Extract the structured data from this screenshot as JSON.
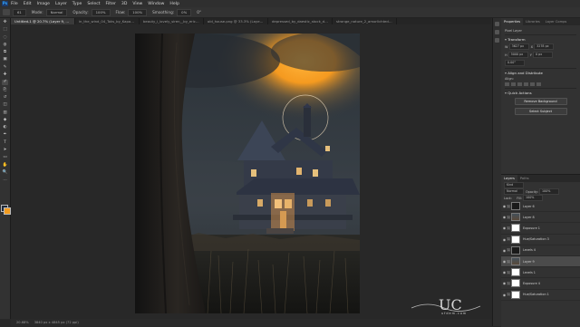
{
  "menu": {
    "logo": "Ps",
    "items": [
      "File",
      "Edit",
      "Image",
      "Layer",
      "Type",
      "Select",
      "Filter",
      "3D",
      "View",
      "Window",
      "Help"
    ]
  },
  "options": {
    "size": "61",
    "mode_label": "Mode:",
    "mode": "Normal",
    "opacity_label": "Opacity:",
    "opacity": "100%",
    "flow_label": "Flow:",
    "flow": "100%",
    "smoothing_label": "Smoothing:",
    "smoothing": "0%",
    "angle": "0°"
  },
  "tabs": [
    {
      "label": "Untitled-1 @ 20.7% (Layer 9, RGB/8#) *",
      "active": true
    },
    {
      "label": "in_the_wind_04_Toks_by_Kapacetstck_d57i8bst.jpg",
      "active": false
    },
    {
      "label": "beauty_i_lovely_siren__by_erica_stock_d3fq6bu.jpg",
      "active": false
    },
    {
      "label": "old_house.png @ 33.3% (Layer 1, RG...",
      "active": false
    },
    {
      "label": "depressed_by_daestic_stock_d15j1m.pnd @...",
      "active": false
    },
    {
      "label": "strange_nature_2_amorlichted_by_storel",
      "active": false
    }
  ],
  "tools": [
    "move-icon",
    "marquee-icon",
    "lasso-icon",
    "quick-select-icon",
    "crop-icon",
    "frame-icon",
    "eyedropper-icon",
    "spot-heal-icon",
    "brush-icon",
    "clone-stamp-icon",
    "history-brush-icon",
    "eraser-icon",
    "gradient-icon",
    "blur-icon",
    "dodge-icon",
    "pen-icon",
    "type-icon",
    "path-select-icon",
    "rectangle-icon",
    "hand-icon",
    "zoom-icon",
    "more-icon"
  ],
  "tool_glyphs": [
    "✥",
    "⬚",
    "◌",
    "◍",
    "⧉",
    "▣",
    "✎",
    "✚",
    "✐",
    "⎘",
    "↺",
    "◫",
    "▥",
    "◆",
    "◐",
    "✒",
    "T",
    "➤",
    "▭",
    "✋",
    "🔍",
    "…"
  ],
  "colors": {
    "foreground": "#1f2a3a",
    "background": "#f39c1f",
    "accent": "#31a8ff"
  },
  "properties": {
    "tabs": [
      "Properties",
      "Libraries",
      "Layer Comps"
    ],
    "layer_type": "Pixel Layer",
    "transform_title": "Transform",
    "w_label": "W",
    "w": "3627 px",
    "h_label": "H",
    "h": "5000 px",
    "x_label": "X",
    "x": "3278 px",
    "y_label": "Y",
    "y": "0 px",
    "angle": "0.00°",
    "align_title": "Align and Distribute",
    "align_sub": "Align:",
    "quick_title": "Quick Actions",
    "remove_bg": "Remove Background",
    "select_subject": "Select Subject"
  },
  "layers": {
    "tabs": [
      "Layers",
      "Paths"
    ],
    "kind": "Kind",
    "blend": "Normal",
    "opacity_label": "Opacity:",
    "opacity": "100%",
    "lock_label": "Lock:",
    "fill_label": "Fill:",
    "fill": "100%",
    "items": [
      {
        "name": "Layer 6",
        "thumb": "dark",
        "selected": false
      },
      {
        "name": "Layer 8",
        "thumb": "img",
        "selected": false
      },
      {
        "name": "Exposure 1",
        "thumb": "white",
        "selected": false
      },
      {
        "name": "Hue/Saturation 3",
        "thumb": "white",
        "selected": false
      },
      {
        "name": "Levels 4",
        "thumb": "dark",
        "selected": false
      },
      {
        "name": "Layer 9",
        "thumb": "img",
        "selected": true
      },
      {
        "name": "Levels 1",
        "thumb": "white",
        "selected": false
      },
      {
        "name": "Exposure 4",
        "thumb": "white",
        "selected": false
      },
      {
        "name": "Hue/Saturation 1",
        "thumb": "white",
        "selected": false
      }
    ]
  },
  "status": {
    "zoom": "20.68%",
    "doc": "3840 px x 4845 px (72 ppi)"
  },
  "watermark": {
    "logo": "UC",
    "sub": "ufdem.com"
  }
}
